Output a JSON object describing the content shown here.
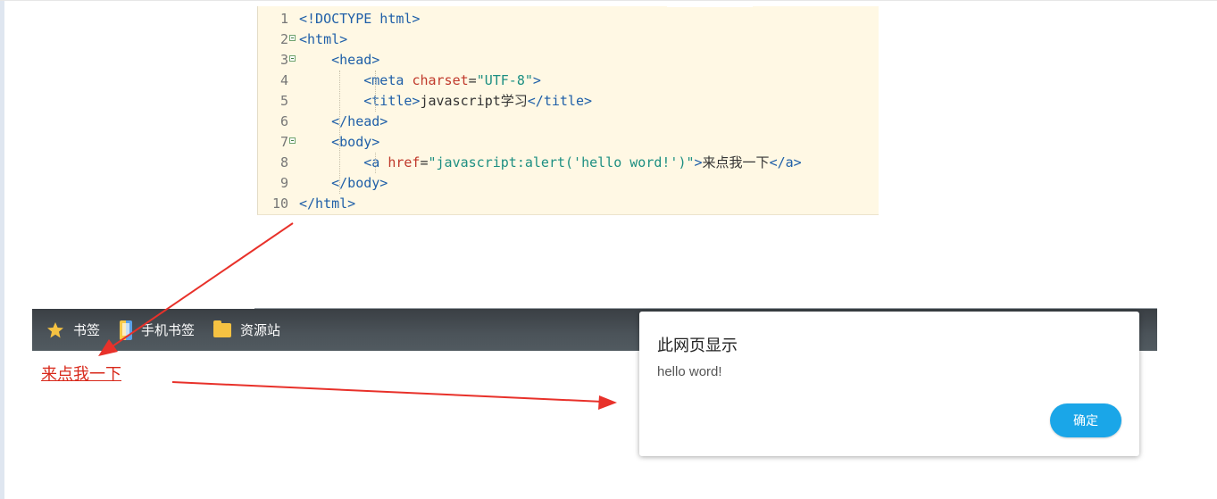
{
  "editor": {
    "lines": [
      {
        "no": "1",
        "parts": [
          [
            "doc",
            "<!DOCTYPE html>"
          ]
        ]
      },
      {
        "no": "2",
        "fold": true,
        "parts": [
          [
            "tag",
            "<html>"
          ]
        ]
      },
      {
        "no": "3",
        "fold": true,
        "parts": [
          [
            "plain",
            "    "
          ],
          [
            "tag",
            "<head>"
          ]
        ]
      },
      {
        "no": "4",
        "parts": [
          [
            "plain",
            "        "
          ],
          [
            "tag",
            "<meta "
          ],
          [
            "attr",
            "charset"
          ],
          [
            "plain",
            "="
          ],
          [
            "str",
            "\"UTF-8\""
          ],
          [
            "tag",
            ">"
          ]
        ]
      },
      {
        "no": "5",
        "parts": [
          [
            "plain",
            "        "
          ],
          [
            "tag",
            "<title>"
          ],
          [
            "plain",
            "javascript学习"
          ],
          [
            "tag",
            "</title>"
          ]
        ]
      },
      {
        "no": "6",
        "parts": [
          [
            "plain",
            "    "
          ],
          [
            "tag",
            "</head>"
          ]
        ]
      },
      {
        "no": "7",
        "fold": true,
        "parts": [
          [
            "plain",
            "    "
          ],
          [
            "tag",
            "<body>"
          ]
        ]
      },
      {
        "no": "8",
        "parts": [
          [
            "plain",
            "        "
          ],
          [
            "tag",
            "<a "
          ],
          [
            "attr",
            "href"
          ],
          [
            "plain",
            "="
          ],
          [
            "str",
            "\"javascript:alert('hello word!')\""
          ],
          [
            "tag",
            ">"
          ],
          [
            "plain",
            "来点我一下"
          ],
          [
            "tag",
            "</a>"
          ]
        ]
      },
      {
        "no": "9",
        "parts": [
          [
            "plain",
            "    "
          ],
          [
            "tag",
            "</body>"
          ]
        ]
      },
      {
        "no": "10",
        "parts": [
          [
            "tag",
            "</html>"
          ]
        ]
      }
    ]
  },
  "bookmarks": {
    "items": [
      {
        "label": "书签",
        "icon": "star-icon"
      },
      {
        "label": "手机书签",
        "icon": "phone-bookmark-icon"
      },
      {
        "label": "资源站",
        "icon": "folder-icon"
      }
    ]
  },
  "page": {
    "link_text": "来点我一下"
  },
  "dialog": {
    "title": "此网页显示",
    "message": "hello word!",
    "ok_label": "确定"
  },
  "colors": {
    "editor_bg": "#fff8e4",
    "arrow": "#e8312a",
    "link": "#d8291b",
    "ok_button": "#1aa6e8"
  }
}
